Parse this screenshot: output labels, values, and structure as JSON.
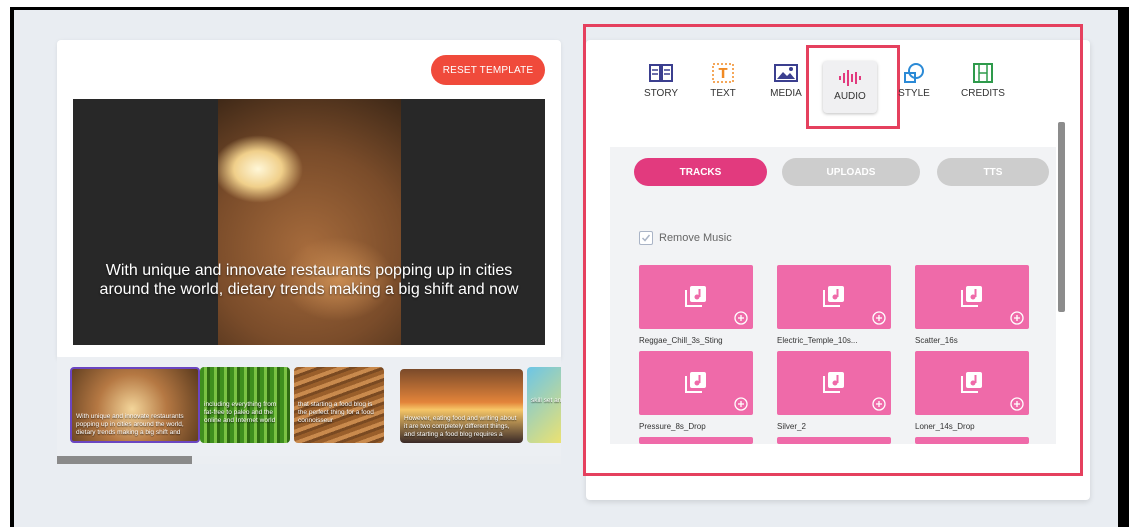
{
  "left": {
    "reset_label": "RESET TEMPLATE",
    "preview_caption": "With unique and innovate restaurants popping up in cities around the world, dietary trends making a big shift and now",
    "thumbnails": [
      {
        "caption": "With unique and innovate restaurants popping up in cities around the world, dietary trends making a big shift and"
      },
      {
        "caption": "including everything from fat-free to paleo and the online and Internet world"
      },
      {
        "caption": "that starting a food blog is the perfect thing for a food connoisseur"
      },
      {
        "caption": "However, eating food and writing about it are two completely different things, and starting a food blog requires a"
      },
      {
        "caption": "skill set an"
      }
    ]
  },
  "tabs": [
    {
      "label": "STORY"
    },
    {
      "label": "TEXT"
    },
    {
      "label": "MEDIA"
    },
    {
      "label": "AUDIO"
    },
    {
      "label": "STYLE"
    },
    {
      "label": "CREDITS"
    }
  ],
  "audio": {
    "pills": {
      "tracks": "TRACKS",
      "uploads": "UPLOADS",
      "tts": "TTS"
    },
    "remove_music_label": "Remove Music",
    "tracks": [
      {
        "name": "Reggae_Chill_3s_Sting"
      },
      {
        "name": "Electric_Temple_10s..."
      },
      {
        "name": "Scatter_16s"
      },
      {
        "name": "Pressure_8s_Drop"
      },
      {
        "name": "Silver_2"
      },
      {
        "name": "Loner_14s_Drop"
      }
    ]
  },
  "colors": {
    "accent": "#e23a7e",
    "reset": "#f04a3b",
    "track_card": "#ef6aa9",
    "highlight": "#e5405e"
  }
}
